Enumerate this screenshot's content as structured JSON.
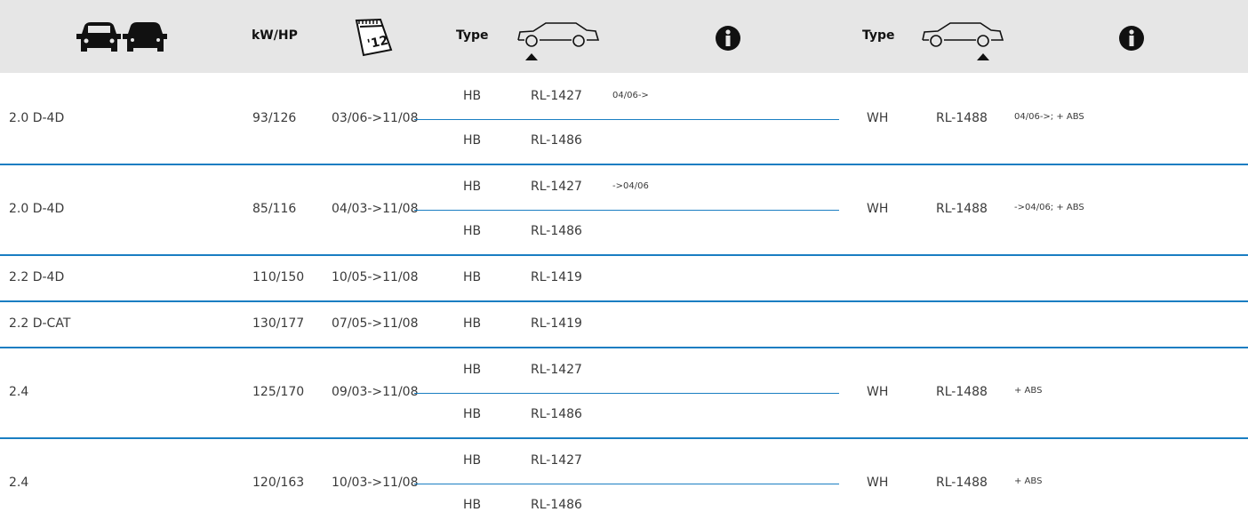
{
  "header": {
    "kwhp_label": "kW/HP",
    "type_front_label": "Type",
    "type_rear_label": "Type",
    "icons": {
      "vehicles": "two-cars-icon",
      "calendar": "calendar-icon",
      "front_axle": "car-front-axle-icon",
      "rear_axle": "car-rear-axle-icon",
      "info": "info-icon"
    },
    "calendar_number": "'12"
  },
  "rows": [
    {
      "engine": "2.0 D-4D",
      "kwhp": "93/126",
      "period": "03/06->11/08",
      "front": [
        {
          "type": "HB",
          "part": "RL-1427",
          "note": "04/06->"
        },
        {
          "type": "HB",
          "part": "RL-1486",
          "note": ""
        }
      ],
      "rear": {
        "type": "WH",
        "part": "RL-1488",
        "note": "04/06->; + ABS"
      }
    },
    {
      "engine": "2.0 D-4D",
      "kwhp": "85/116",
      "period": "04/03->11/08",
      "front": [
        {
          "type": "HB",
          "part": "RL-1427",
          "note": "->04/06"
        },
        {
          "type": "HB",
          "part": "RL-1486",
          "note": ""
        }
      ],
      "rear": {
        "type": "WH",
        "part": "RL-1488",
        "note": "->04/06; + ABS"
      }
    },
    {
      "engine": "2.2 D-4D",
      "kwhp": "110/150",
      "period": "10/05->11/08",
      "front": [
        {
          "type": "HB",
          "part": "RL-1419",
          "note": ""
        }
      ]
    },
    {
      "engine": "2.2 D-CAT",
      "kwhp": "130/177",
      "period": "07/05->11/08",
      "front": [
        {
          "type": "HB",
          "part": "RL-1419",
          "note": ""
        }
      ]
    },
    {
      "engine": "2.4",
      "kwhp": "125/170",
      "period": "09/03->11/08",
      "front": [
        {
          "type": "HB",
          "part": "RL-1427",
          "note": ""
        },
        {
          "type": "HB",
          "part": "RL-1486",
          "note": ""
        }
      ],
      "rear": {
        "type": "WH",
        "part": "RL-1488",
        "note": "+ ABS"
      }
    },
    {
      "engine": "2.4",
      "kwhp": "120/163",
      "period": "10/03->11/08",
      "front": [
        {
          "type": "HB",
          "part": "RL-1427",
          "note": ""
        },
        {
          "type": "HB",
          "part": "RL-1486",
          "note": ""
        }
      ],
      "rear": {
        "type": "WH",
        "part": "RL-1488",
        "note": "+ ABS"
      }
    }
  ],
  "colors": {
    "header_bg": "#e6e6e6",
    "divider": "#1a7ec2",
    "text": "#3a3a3a",
    "icon": "#111111"
  }
}
